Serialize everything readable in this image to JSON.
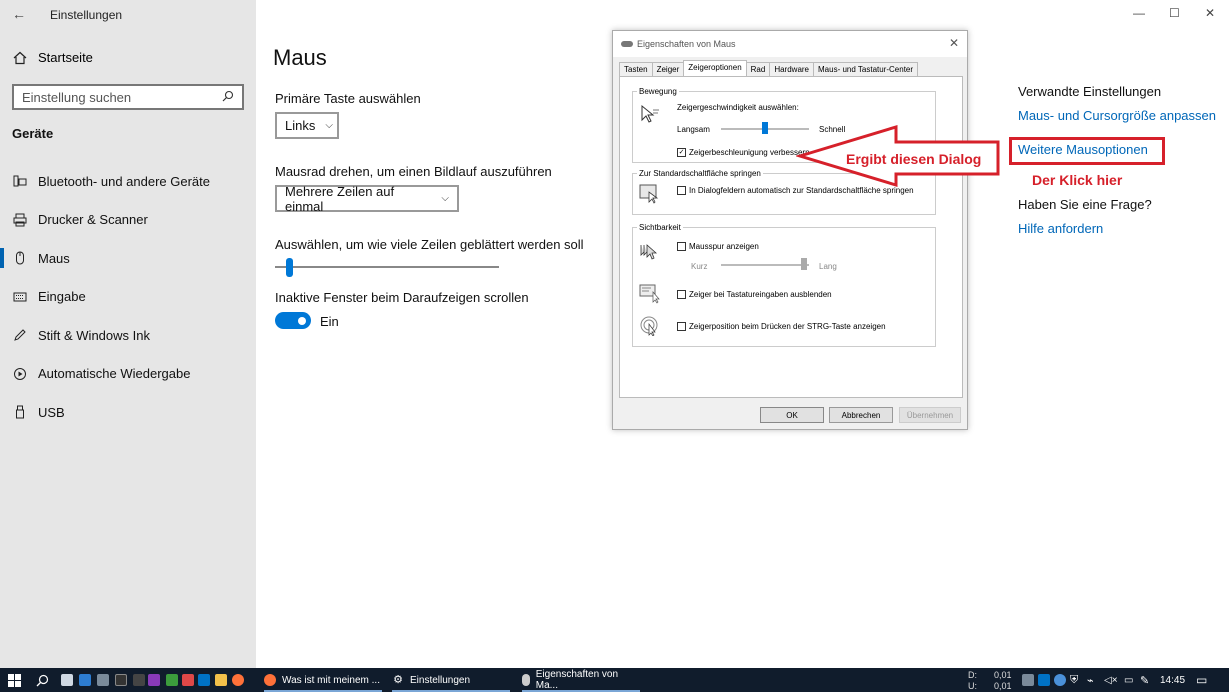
{
  "window": {
    "title": "Einstellungen",
    "back_glyph": "←",
    "min_glyph": "—",
    "max_glyph": "☐",
    "close_glyph": "✕"
  },
  "sidebar": {
    "home_label": "Startseite",
    "search_placeholder": "Einstellung suchen",
    "section_title": "Geräte",
    "items": [
      {
        "label": "Bluetooth- und andere Geräte",
        "icon": "bluetooth-device-icon",
        "active": false
      },
      {
        "label": "Drucker & Scanner",
        "icon": "printer-icon",
        "active": false
      },
      {
        "label": "Maus",
        "icon": "mouse-icon",
        "active": true
      },
      {
        "label": "Eingabe",
        "icon": "keyboard-icon",
        "active": false
      },
      {
        "label": "Stift & Windows Ink",
        "icon": "pen-icon",
        "active": false
      },
      {
        "label": "Automatische Wiedergabe",
        "icon": "autoplay-icon",
        "active": false
      },
      {
        "label": "USB",
        "icon": "usb-icon",
        "active": false
      }
    ]
  },
  "main": {
    "title": "Maus",
    "primary_button_label": "Primäre Taste auswählen",
    "primary_button_value": "Links",
    "scroll_label": "Mausrad drehen, um einen Bildlauf auszuführen",
    "scroll_value": "Mehrere Zeilen auf einmal",
    "lines_label": "Auswählen, um wie viele Zeilen geblättert werden soll",
    "lines_slider_fraction": 0.05,
    "inactive_scroll_label": "Inaktive Fenster beim Daraufzeigen scrollen",
    "inactive_scroll_state": "Ein"
  },
  "related": {
    "heading": "Verwandte Einstellungen",
    "link1": "Maus- und Cursorgröße anpassen",
    "link2": "Weitere Mausoptionen",
    "question": "Haben Sie eine Frage?",
    "help_link": "Hilfe anfordern"
  },
  "dialog": {
    "title": "Eigenschaften von Maus",
    "tabs": [
      "Tasten",
      "Zeiger",
      "Zeigeroptionen",
      "Rad",
      "Hardware",
      "Maus- und Tastatur-Center"
    ],
    "active_tab": "Zeigeroptionen",
    "group_motion": "Bewegung",
    "speed_label": "Zeigergeschwindigkeit auswählen:",
    "slow": "Langsam",
    "fast": "Schnell",
    "speed_fraction": 0.5,
    "precision_label": "Zeigerbeschleunigung verbessern",
    "precision_checked": true,
    "group_snap": "Zur Standardschaltfläche springen",
    "snap_label": "In Dialogfeldern automatisch zur Standardschaltfläche springen",
    "group_visibility": "Sichtbarkeit",
    "trails_label": "Mausspur anzeigen",
    "short": "Kurz",
    "long": "Lang",
    "hide_label": "Zeiger bei Tastatureingaben ausblenden",
    "ctrl_label": "Zeigerposition beim Drücken der STRG-Taste anzeigen",
    "ok": "OK",
    "cancel": "Abbrechen",
    "apply": "Übernehmen"
  },
  "annotations": {
    "arrow_text": "Ergibt diesen Dialog",
    "click_text": "Der Klick hier",
    "color": "#d6202a"
  },
  "taskbar": {
    "task1": "Was ist mit meinem ...",
    "task2": "Einstellungen",
    "task3": "Eigenschaften von Ma...",
    "disk_d_label": "D:",
    "disk_d_value": "0,01",
    "disk_u_label": "U:",
    "disk_u_value": "0,01",
    "time": "14:45"
  },
  "colors": {
    "accent": "#0078d7",
    "link": "#0067b8",
    "sidebar_bg": "#e6e6e6",
    "taskbar_bg": "#101c2c"
  }
}
